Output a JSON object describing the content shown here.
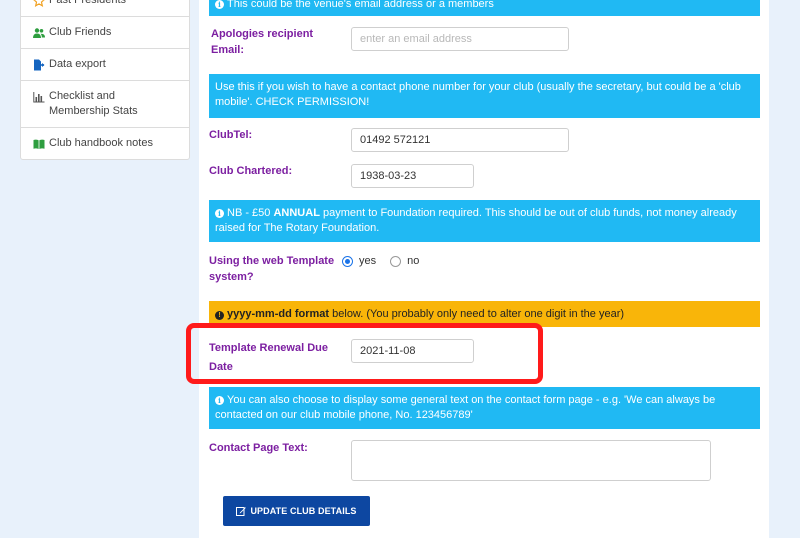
{
  "sidebar": {
    "items": [
      {
        "label": "Past Presidents",
        "icon": "star-icon"
      },
      {
        "label": "Club Friends",
        "icon": "users-icon"
      },
      {
        "label": "Data export",
        "icon": "export-icon"
      },
      {
        "label": "Checklist and Membership Stats",
        "icon": "bar-chart-icon"
      },
      {
        "label": "Club handbook notes",
        "icon": "book-icon"
      }
    ]
  },
  "form": {
    "top_notice": "This could be the venue's email address or a members",
    "apologies_label": "Apologies recipient Email:",
    "apologies_placeholder": "enter an email address",
    "phone_notice": "Use this if you wish to have a contact phone number for your club (usually the secretary, but could be a 'club mobile'. CHECK PERMISSION!",
    "clubtel_label": "ClubTel:",
    "clubtel_value": "01492 572121",
    "chartered_label": "Club Chartered:",
    "chartered_value": "1938-03-23",
    "annual_notice_pre": "NB - £50 ",
    "annual_notice_bold": "ANNUAL",
    "annual_notice_post": " payment to Foundation required. This should be out of club funds, not money already raised for The Rotary Foundation.",
    "template_label": "Using the web Template system?",
    "template_yes": "yes",
    "template_no": "no",
    "template_selected": "yes",
    "format_notice_bold": "yyyy-mm-dd format",
    "format_notice_post": " below. (You probably only need to alter one digit in the year)",
    "renewal_label": "Template Renewal Due Date",
    "renewal_value": "2021-11-08",
    "contact_notice": "You can also choose to display some general text on the contact form page - e.g. 'We can always be contacted on our club mobile phone, No. 123456789'",
    "contact_label": "Contact Page Text:",
    "contact_value": "",
    "update_button": "UPDATE CLUB DETAILS"
  },
  "colors": {
    "info": "#20b9f3",
    "warning": "#f9b509",
    "label": "#7c1fa1",
    "button": "#0d47a1",
    "highlight": "#ff1a1a"
  }
}
